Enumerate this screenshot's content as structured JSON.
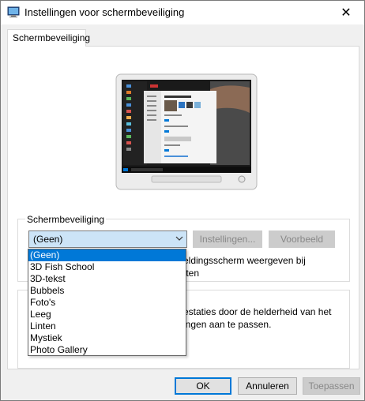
{
  "window": {
    "title": "Instellingen voor schermbeveiliging",
    "close_glyph": "✕"
  },
  "tabs": [
    {
      "label": "Schermbeveiliging"
    }
  ],
  "screensaver": {
    "group_label": "Schermbeveiliging",
    "selected_value": "(Geen)",
    "settings_label": "Instellingen...",
    "preview_label": "Voorbeeld",
    "resume_text_1": "eldingsscherm weergeven bij",
    "resume_text_2": "tten",
    "options": [
      "(Geen)",
      "3D Fish School",
      "3D-tekst",
      "Bubbels",
      "Foto's",
      "Leeg",
      "Linten",
      "Mystiek",
      "Photo Gallery"
    ]
  },
  "power": {
    "text_1": "estaties door de helderheid van het",
    "text_2": "ingen aan te passen."
  },
  "footer": {
    "ok_label": "OK",
    "cancel_label": "Annuleren",
    "apply_label": "Toepassen"
  },
  "colors": {
    "accent": "#0078d7",
    "select_bg": "#cce4f7"
  },
  "icons": {
    "app": "screensaver-app-icon",
    "close": "close-icon",
    "dropdown": "chevron-down-icon"
  }
}
